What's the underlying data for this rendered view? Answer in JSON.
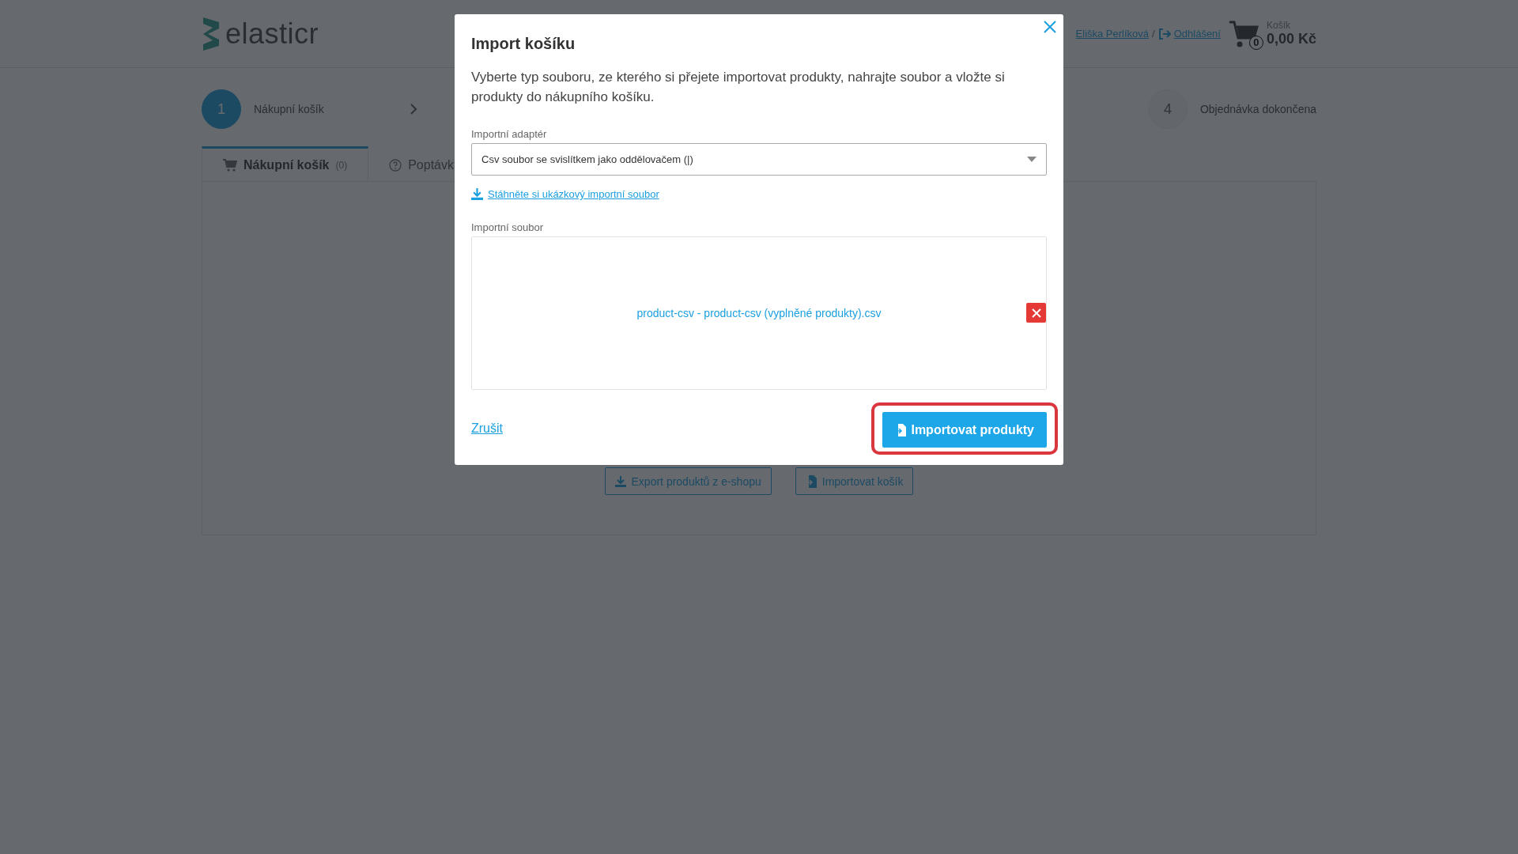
{
  "header": {
    "logo": "elasticr",
    "user": "Eliška Perlíková",
    "separator": "/",
    "logout": "Odhlášení",
    "cart": {
      "label": "Košík",
      "count": "0",
      "total": "0,00 Kč"
    }
  },
  "steps": [
    {
      "number": "1",
      "label": "Nákupní košík",
      "selected": true
    },
    {
      "number": "4",
      "label": "Objednávka dokončena",
      "selected": false
    }
  ],
  "tabs": [
    {
      "label": "Nákupní košík",
      "count": "(0)",
      "kind": "cart",
      "selected": true
    },
    {
      "label": "Poptávk",
      "kind": "question",
      "selected": false
    }
  ],
  "panel": {
    "buttons": [
      {
        "label": "Export produktů z e-shopu",
        "kind": "download"
      },
      {
        "label": "Importovat košík",
        "kind": "import"
      }
    ]
  },
  "modal": {
    "title": "Import košíku",
    "description": "Vyberte typ souboru, ze kterého si přejete importovat produkty, nahrajte soubor a vložte si produkty do nákupního košíku.",
    "adapter_label": "Importní adaptér",
    "adapter_value": "Csv soubor se svislítkem jako oddělovačem (|)",
    "sample_link": "Stáhněte si ukázkový importní soubor",
    "file_label": "Importní soubor",
    "file_name": "product-csv - product-csv (vyplněné produkty).csv",
    "cancel": "Zrušit",
    "submit": "Importovat produkty",
    "submit_highlighted": true
  }
}
